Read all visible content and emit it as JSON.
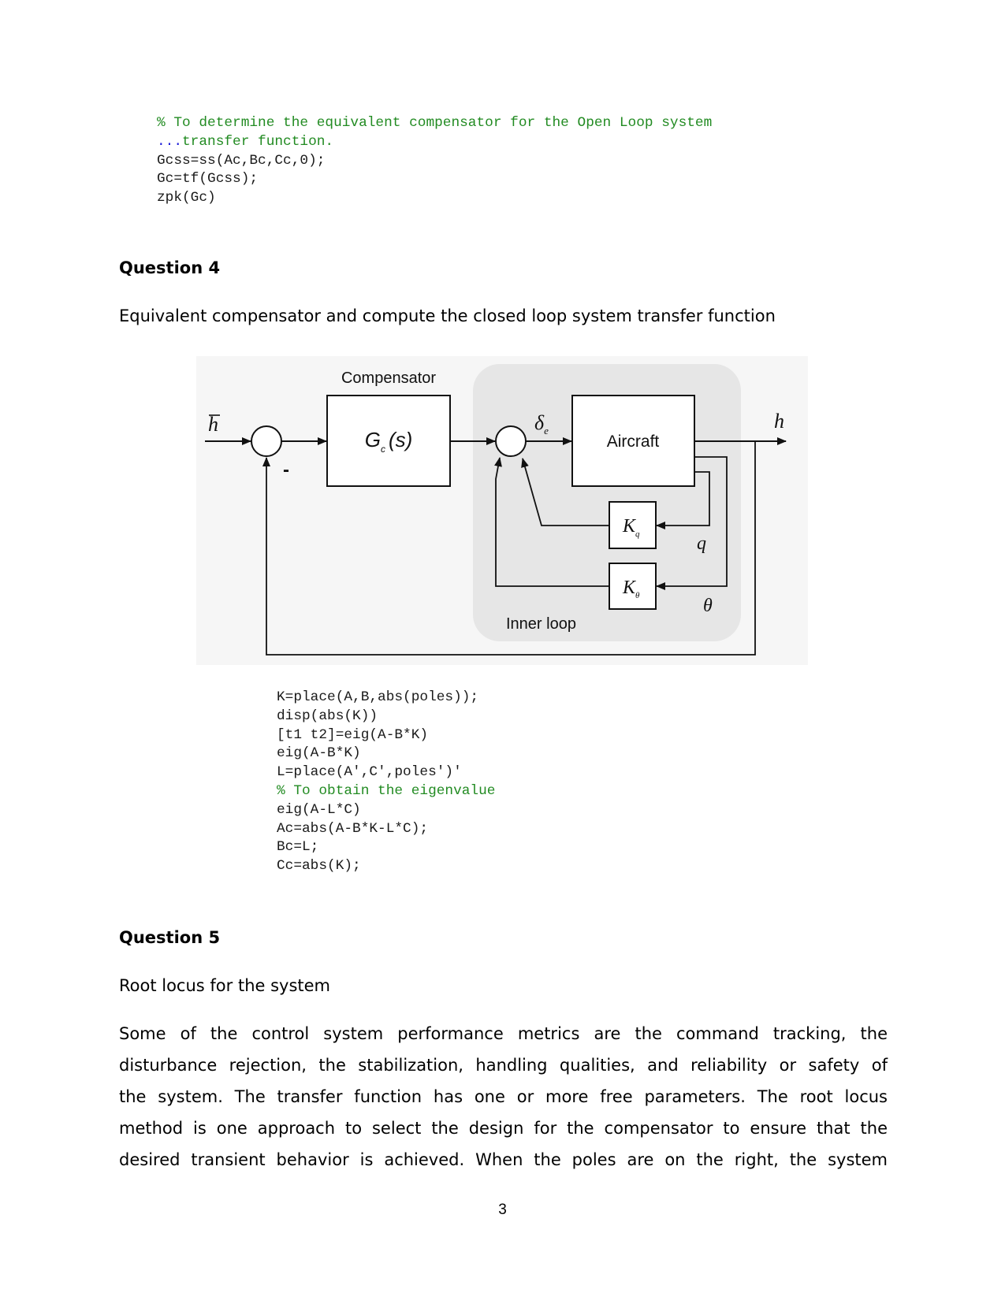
{
  "code_block_1": {
    "lines": [
      {
        "kind": "comment",
        "text": "% To determine the equivalent compensator for the Open Loop system"
      },
      {
        "kind": "continuation",
        "prefix": "...",
        "text": "transfer function."
      },
      {
        "kind": "code",
        "text": "Gcss=ss(Ac,Bc,Cc,0);"
      },
      {
        "kind": "code",
        "text": "Gc=tf(Gcss);"
      },
      {
        "kind": "code",
        "text": "zpk(Gc)"
      }
    ]
  },
  "question4": {
    "heading": "Question 4",
    "subtitle": "Equivalent compensator and compute the closed loop system transfer function"
  },
  "diagram": {
    "input_label": "h",
    "output_label": "h",
    "minus_sign": "-",
    "compensator_title": "Compensator",
    "compensator_block": {
      "main": "G",
      "sub": "c",
      "arg": "(s)"
    },
    "delta_label": {
      "main": "δ",
      "sub": "e"
    },
    "aircraft_label": "Aircraft",
    "kq_block": {
      "main": "K",
      "sub": "q"
    },
    "ktheta_block": {
      "main": "K",
      "sub": "θ"
    },
    "q_label": "q",
    "theta_label": "θ",
    "inner_loop_label": "Inner loop",
    "colors": {
      "background": "#f6f6f6",
      "inner_loop": "#e6e6e6",
      "stroke": "#111111"
    }
  },
  "code_block_2": {
    "lines": [
      {
        "kind": "code",
        "text": "K=place(A,B,abs(poles));"
      },
      {
        "kind": "code",
        "text": "disp(abs(K))"
      },
      {
        "kind": "code",
        "text": "[t1 t2]=eig(A-B*K)"
      },
      {
        "kind": "code",
        "text": "eig(A-B*K)"
      },
      {
        "kind": "code",
        "text": "L=place(A',C',poles')'"
      },
      {
        "kind": "comment",
        "text": "% To obtain the eigenvalue"
      },
      {
        "kind": "code",
        "text": "eig(A-L*C)"
      },
      {
        "kind": "code",
        "text": "Ac=abs(A-B*K-L*C);"
      },
      {
        "kind": "code",
        "text": "Bc=L;"
      },
      {
        "kind": "code",
        "text": "Cc=abs(K);"
      }
    ]
  },
  "question5": {
    "heading": "Question 5",
    "subtitle": "Root locus for the system",
    "paragraph_lines": [
      "Some of the control system performance metrics are the command tracking, the",
      "disturbance rejection, the stabilization, handling qualities, and reliability or safety of",
      "the system. The transfer function has one or more free parameters. The root locus",
      "method is one approach to select the design for the compensator to ensure that the",
      "desired transient behavior is achieved. When the poles are on the right, the system"
    ]
  },
  "page_number": "3",
  "colors": {
    "comment": "#228b22",
    "continuation": "#1c1cd8",
    "code_text": "#1a1a1a"
  }
}
